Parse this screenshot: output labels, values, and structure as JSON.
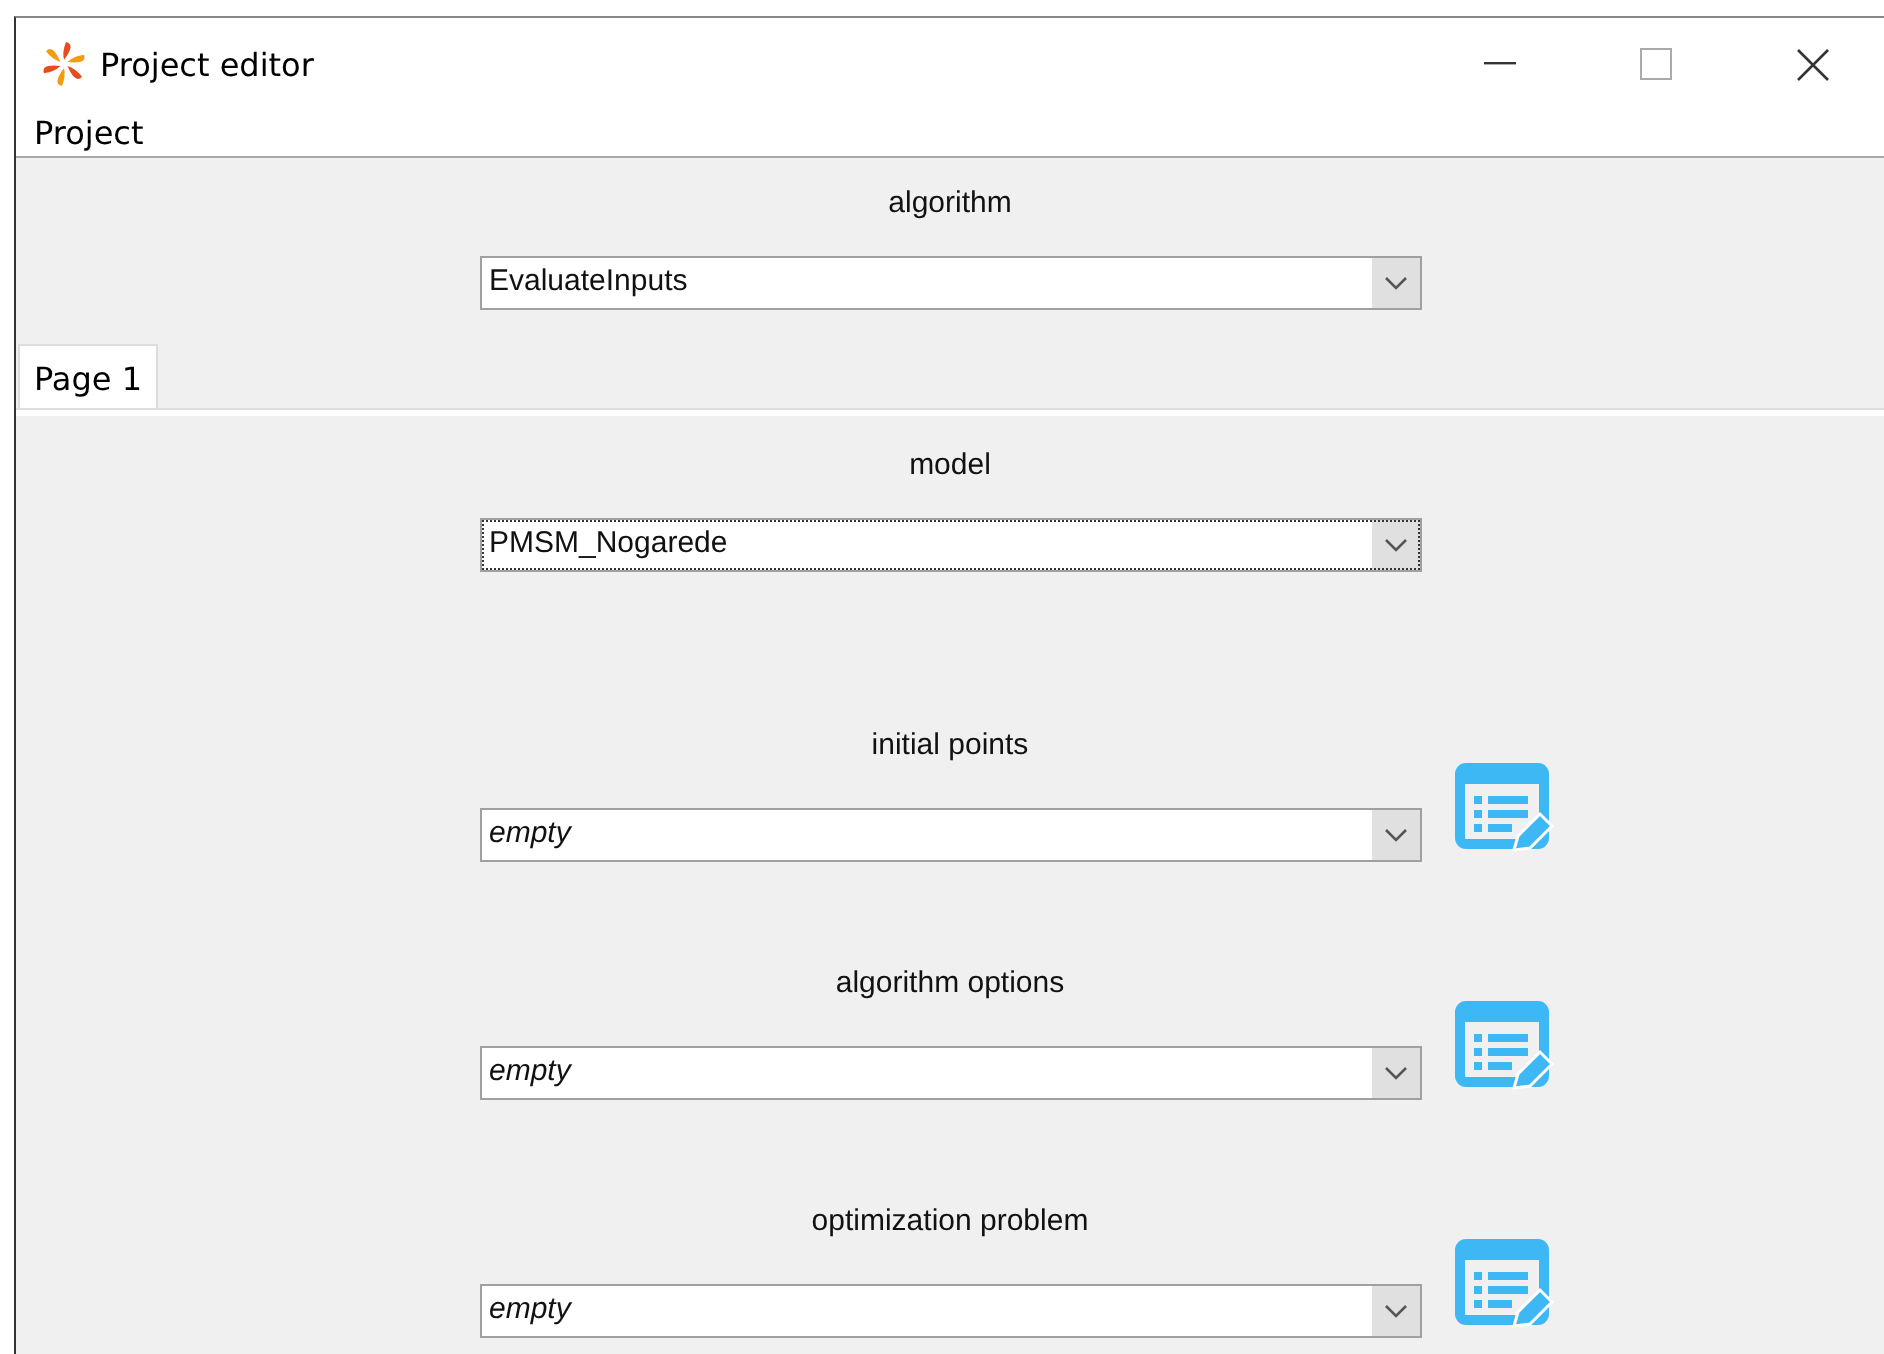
{
  "window": {
    "title": "Project editor"
  },
  "menu": [
    "Project"
  ],
  "algorithm": {
    "label": "algorithm",
    "value": "EvaluateInputs",
    "focused": false
  },
  "tabs": [
    {
      "label": "Page 1",
      "selected": true
    }
  ],
  "fields": [
    {
      "kind": "plain",
      "label": "model",
      "value": "PMSM_Nogarede",
      "focused": true
    },
    {
      "kind": "editable",
      "label": "initial points",
      "value": "empty",
      "focused": false
    },
    {
      "kind": "editable",
      "label": "algorithm options",
      "value": "empty",
      "focused": false
    },
    {
      "kind": "editable",
      "label": "optimization problem",
      "value": "empty",
      "focused": false
    }
  ]
}
